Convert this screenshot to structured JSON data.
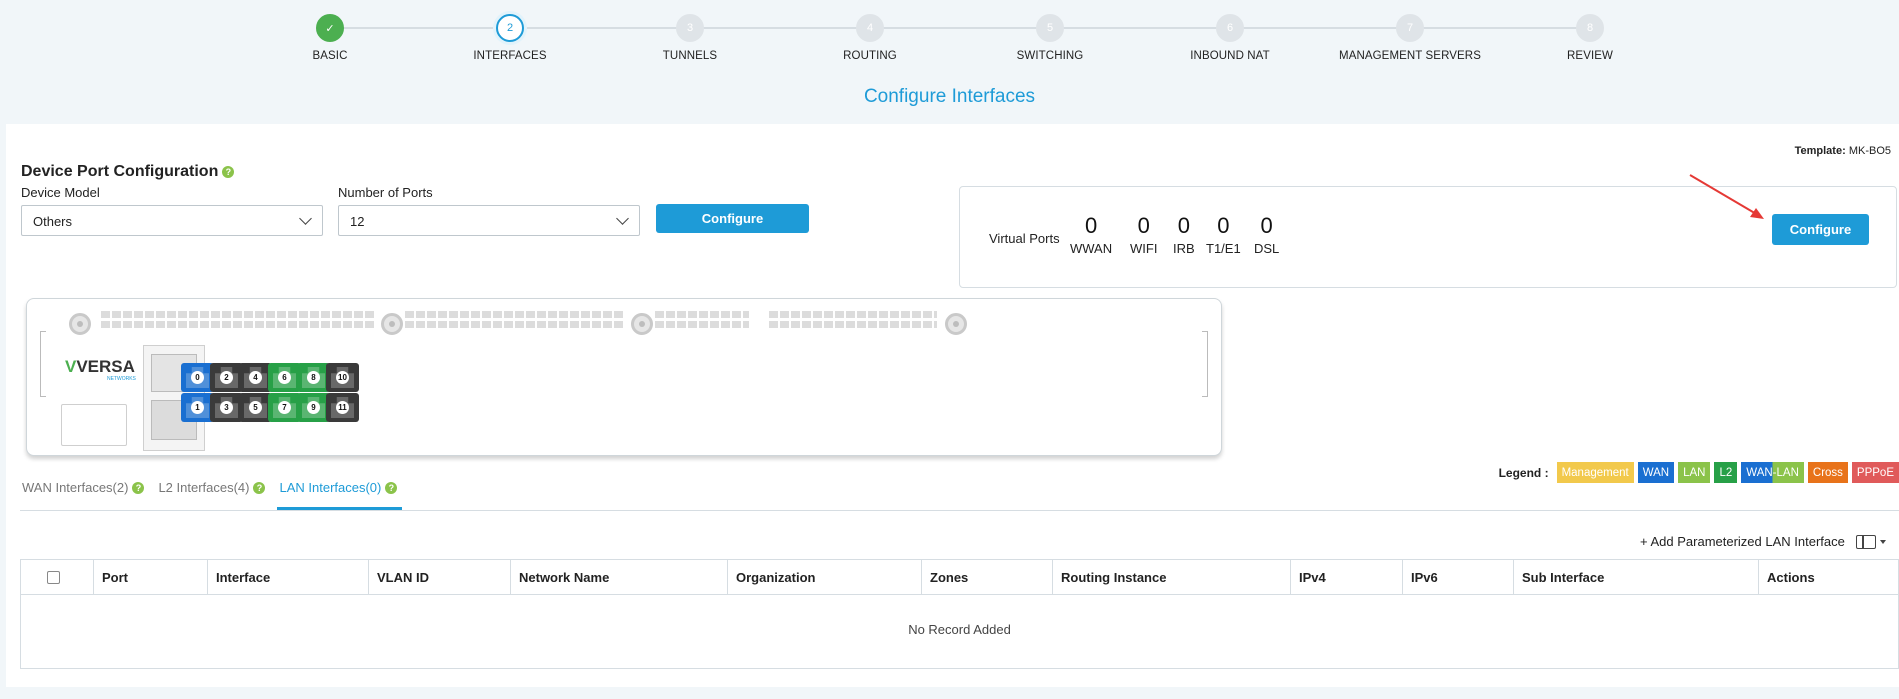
{
  "wizard": {
    "steps": [
      {
        "num": "✓",
        "label": "BASIC",
        "state": "done"
      },
      {
        "num": "2",
        "label": "INTERFACES",
        "state": "active"
      },
      {
        "num": "3",
        "label": "TUNNELS",
        "state": "pending"
      },
      {
        "num": "4",
        "label": "ROUTING",
        "state": "pending"
      },
      {
        "num": "5",
        "label": "SWITCHING",
        "state": "pending"
      },
      {
        "num": "6",
        "label": "INBOUND NAT",
        "state": "pending"
      },
      {
        "num": "7",
        "label": "MANAGEMENT SERVERS",
        "state": "pending"
      },
      {
        "num": "8",
        "label": "REVIEW",
        "state": "pending"
      }
    ]
  },
  "page_title": "Configure Interfaces",
  "template": {
    "label": "Template:",
    "value": "MK-BO5"
  },
  "device_port_config": {
    "title": "Device Port Configuration",
    "help": "?",
    "device_model_label": "Device Model",
    "device_model_value": "Others",
    "ports_label": "Number of Ports",
    "ports_value": "12",
    "configure_label": "Configure"
  },
  "virtual_ports": {
    "label": "Virtual Ports",
    "items": [
      {
        "count": "0",
        "label": "WWAN"
      },
      {
        "count": "0",
        "label": "WIFI"
      },
      {
        "count": "0",
        "label": "IRB"
      },
      {
        "count": "0",
        "label": "T1/E1"
      },
      {
        "count": "0",
        "label": "DSL"
      }
    ],
    "configure_label": "Configure"
  },
  "device": {
    "logo": "VERSA",
    "logo_sub": "NETWORKS",
    "ports_top": [
      {
        "num": "0",
        "color": "blue"
      },
      {
        "num": "2",
        "color": "dark"
      },
      {
        "num": "4",
        "color": "dark"
      },
      {
        "num": "6",
        "color": "green"
      },
      {
        "num": "8",
        "color": "green"
      },
      {
        "num": "10",
        "color": "dark"
      }
    ],
    "ports_bottom": [
      {
        "num": "1",
        "color": "blue"
      },
      {
        "num": "3",
        "color": "dark"
      },
      {
        "num": "5",
        "color": "dark"
      },
      {
        "num": "7",
        "color": "green"
      },
      {
        "num": "9",
        "color": "green"
      },
      {
        "num": "11",
        "color": "dark"
      }
    ]
  },
  "legend": {
    "title": "Legend :",
    "items": [
      {
        "label": "Management",
        "color": "#f2c94c"
      },
      {
        "label": "WAN",
        "color": "#1a6fd1"
      },
      {
        "label": "LAN",
        "color": "#8bc34a"
      },
      {
        "label": "L2",
        "color": "#27a047"
      },
      {
        "label": "WAN-LAN",
        "color": "#1a6fd1"
      },
      {
        "label": "Cross",
        "color": "#e8731a"
      },
      {
        "label": "PPPoE",
        "color": "#e05a5a"
      }
    ]
  },
  "tabs": [
    {
      "label": "WAN Interfaces(2)",
      "active": false
    },
    {
      "label": "L2 Interfaces(4)",
      "active": false
    },
    {
      "label": "LAN Interfaces(0)",
      "active": true
    }
  ],
  "table": {
    "add_label": "+ Add Parameterized LAN Interface",
    "columns": [
      "Port",
      "Interface",
      "VLAN ID",
      "Network Name",
      "Organization",
      "Zones",
      "Routing Instance",
      "IPv4",
      "IPv6",
      "Sub Interface",
      "Actions"
    ],
    "empty_text": "No Record Added"
  }
}
